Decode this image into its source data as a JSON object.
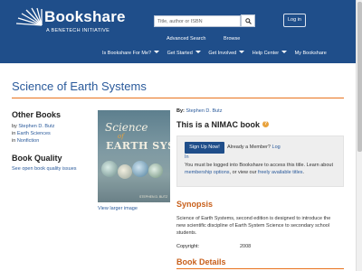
{
  "header": {
    "logo_text": "Bookshare",
    "logo_sub": "A BENETECH INITIATIVE",
    "search_placeholder": "Title, author or ISBN",
    "login_label": "Log in",
    "sub_nav": [
      "Advanced Search",
      "Browse"
    ],
    "main_nav": [
      {
        "label": "Is Bookshare For Me?",
        "dropdown": true
      },
      {
        "label": "Get Started",
        "dropdown": true
      },
      {
        "label": "Get Involved",
        "dropdown": true
      },
      {
        "label": "Help Center",
        "dropdown": true
      },
      {
        "label": "My Bookshare",
        "dropdown": false
      }
    ],
    "brand_color": "#1f4e8a"
  },
  "page": {
    "title": "Science of Earth Systems",
    "accent_color": "#e8721c"
  },
  "sidebar": {
    "other_books_heading": "Other Books",
    "by_prefix": "by ",
    "author": "Stephen D. Butz",
    "in_prefix": "in ",
    "category_1": "Earth Sciences",
    "category_2": "Nonfiction",
    "book_quality_heading": "Book Quality",
    "book_quality_link": "See open book quality issues"
  },
  "cover": {
    "line1": "Science",
    "line2": "of",
    "line3": "EARTH SYSTEMS",
    "author": "STEPHEN D. BUTZ",
    "view_larger": "View larger image"
  },
  "details": {
    "by_label": "By:",
    "author": "Stephen D. Butz",
    "nimac_heading": "This is a NIMAC book",
    "signup_label": "Sign Up Now!",
    "member_question": "Already a Member?",
    "login_part1": "Log",
    "login_part2": "In",
    "note_1": "You must be logged into Bookshare to access this title. Learn about ",
    "note_link_1": "membership options",
    "note_2": ", or view our ",
    "note_link_2": "freely available titles",
    "note_3": ".",
    "synopsis_heading": "Synopsis",
    "synopsis": "Science of Earth Systems, second edition is designed to introduce the new scientific discipline of Earth System Science to secondary school students.",
    "copyright_label": "Copyright:",
    "copyright_value": "2008",
    "book_details_heading": "Book Details"
  }
}
